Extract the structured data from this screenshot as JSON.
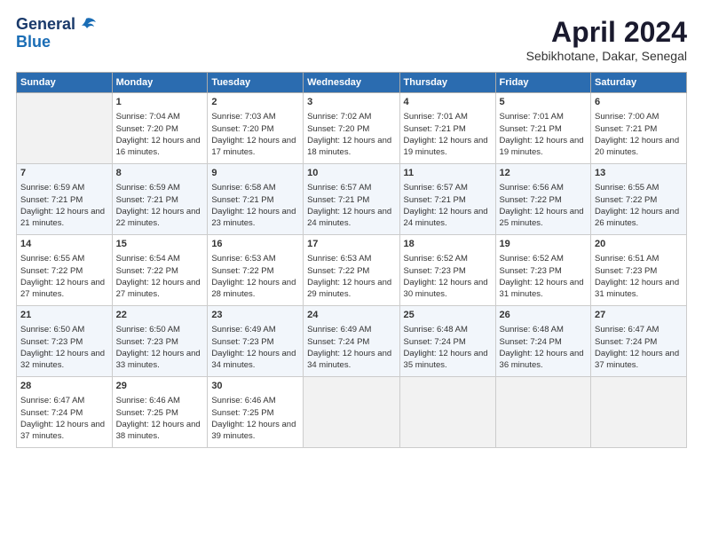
{
  "header": {
    "logo_line1": "General",
    "logo_line2": "Blue",
    "month": "April 2024",
    "location": "Sebikhotane, Dakar, Senegal"
  },
  "weekdays": [
    "Sunday",
    "Monday",
    "Tuesday",
    "Wednesday",
    "Thursday",
    "Friday",
    "Saturday"
  ],
  "weeks": [
    [
      {
        "day": "",
        "empty": true
      },
      {
        "day": "1",
        "sunrise": "7:04 AM",
        "sunset": "7:20 PM",
        "daylight": "12 hours and 16 minutes."
      },
      {
        "day": "2",
        "sunrise": "7:03 AM",
        "sunset": "7:20 PM",
        "daylight": "12 hours and 17 minutes."
      },
      {
        "day": "3",
        "sunrise": "7:02 AM",
        "sunset": "7:20 PM",
        "daylight": "12 hours and 18 minutes."
      },
      {
        "day": "4",
        "sunrise": "7:01 AM",
        "sunset": "7:21 PM",
        "daylight": "12 hours and 19 minutes."
      },
      {
        "day": "5",
        "sunrise": "7:01 AM",
        "sunset": "7:21 PM",
        "daylight": "12 hours and 19 minutes."
      },
      {
        "day": "6",
        "sunrise": "7:00 AM",
        "sunset": "7:21 PM",
        "daylight": "12 hours and 20 minutes."
      }
    ],
    [
      {
        "day": "7",
        "sunrise": "6:59 AM",
        "sunset": "7:21 PM",
        "daylight": "12 hours and 21 minutes."
      },
      {
        "day": "8",
        "sunrise": "6:59 AM",
        "sunset": "7:21 PM",
        "daylight": "12 hours and 22 minutes."
      },
      {
        "day": "9",
        "sunrise": "6:58 AM",
        "sunset": "7:21 PM",
        "daylight": "12 hours and 23 minutes."
      },
      {
        "day": "10",
        "sunrise": "6:57 AM",
        "sunset": "7:21 PM",
        "daylight": "12 hours and 24 minutes."
      },
      {
        "day": "11",
        "sunrise": "6:57 AM",
        "sunset": "7:21 PM",
        "daylight": "12 hours and 24 minutes."
      },
      {
        "day": "12",
        "sunrise": "6:56 AM",
        "sunset": "7:22 PM",
        "daylight": "12 hours and 25 minutes."
      },
      {
        "day": "13",
        "sunrise": "6:55 AM",
        "sunset": "7:22 PM",
        "daylight": "12 hours and 26 minutes."
      }
    ],
    [
      {
        "day": "14",
        "sunrise": "6:55 AM",
        "sunset": "7:22 PM",
        "daylight": "12 hours and 27 minutes."
      },
      {
        "day": "15",
        "sunrise": "6:54 AM",
        "sunset": "7:22 PM",
        "daylight": "12 hours and 27 minutes."
      },
      {
        "day": "16",
        "sunrise": "6:53 AM",
        "sunset": "7:22 PM",
        "daylight": "12 hours and 28 minutes."
      },
      {
        "day": "17",
        "sunrise": "6:53 AM",
        "sunset": "7:22 PM",
        "daylight": "12 hours and 29 minutes."
      },
      {
        "day": "18",
        "sunrise": "6:52 AM",
        "sunset": "7:23 PM",
        "daylight": "12 hours and 30 minutes."
      },
      {
        "day": "19",
        "sunrise": "6:52 AM",
        "sunset": "7:23 PM",
        "daylight": "12 hours and 31 minutes."
      },
      {
        "day": "20",
        "sunrise": "6:51 AM",
        "sunset": "7:23 PM",
        "daylight": "12 hours and 31 minutes."
      }
    ],
    [
      {
        "day": "21",
        "sunrise": "6:50 AM",
        "sunset": "7:23 PM",
        "daylight": "12 hours and 32 minutes."
      },
      {
        "day": "22",
        "sunrise": "6:50 AM",
        "sunset": "7:23 PM",
        "daylight": "12 hours and 33 minutes."
      },
      {
        "day": "23",
        "sunrise": "6:49 AM",
        "sunset": "7:23 PM",
        "daylight": "12 hours and 34 minutes."
      },
      {
        "day": "24",
        "sunrise": "6:49 AM",
        "sunset": "7:24 PM",
        "daylight": "12 hours and 34 minutes."
      },
      {
        "day": "25",
        "sunrise": "6:48 AM",
        "sunset": "7:24 PM",
        "daylight": "12 hours and 35 minutes."
      },
      {
        "day": "26",
        "sunrise": "6:48 AM",
        "sunset": "7:24 PM",
        "daylight": "12 hours and 36 minutes."
      },
      {
        "day": "27",
        "sunrise": "6:47 AM",
        "sunset": "7:24 PM",
        "daylight": "12 hours and 37 minutes."
      }
    ],
    [
      {
        "day": "28",
        "sunrise": "6:47 AM",
        "sunset": "7:24 PM",
        "daylight": "12 hours and 37 minutes."
      },
      {
        "day": "29",
        "sunrise": "6:46 AM",
        "sunset": "7:25 PM",
        "daylight": "12 hours and 38 minutes."
      },
      {
        "day": "30",
        "sunrise": "6:46 AM",
        "sunset": "7:25 PM",
        "daylight": "12 hours and 39 minutes."
      },
      {
        "day": "",
        "empty": true
      },
      {
        "day": "",
        "empty": true
      },
      {
        "day": "",
        "empty": true
      },
      {
        "day": "",
        "empty": true
      }
    ]
  ]
}
